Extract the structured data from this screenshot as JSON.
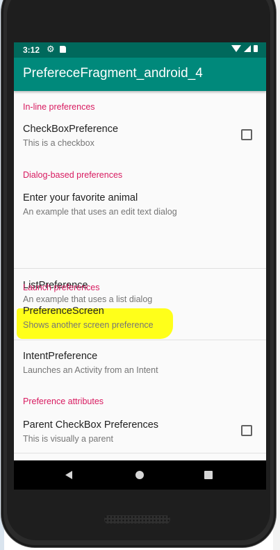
{
  "statusbar": {
    "time": "3:12"
  },
  "appbar": {
    "title": "PrefereceFragment_android_4"
  },
  "preferences": {
    "inline_header": "In-line preferences",
    "checkbox_title": "CheckBoxPreference",
    "checkbox_summary": "This is a checkbox",
    "checkbox_checked": false,
    "dialog_header": "Dialog-based preferences",
    "edittext_title": "Enter your favorite animal",
    "edittext_summary": "An example that uses an edit text dialog",
    "list_title": "ListPreference",
    "list_summary": "An example that uses a list dialog",
    "launch_header": "Launch preferences",
    "screen_title": "PreferenceScreen",
    "screen_summary": "Shows another screen preference",
    "intent_title": "IntentPreference",
    "intent_summary": "Launches an Activity from an Intent",
    "attributes_header": "Preference attributes",
    "parent_title": "Parent CheckBox Preferences",
    "parent_summary": "This is visually a parent",
    "parent_checked": false
  },
  "colors": {
    "statusbar": "#00695c",
    "appbar": "#00897b",
    "category": "#d81b60",
    "highlight": "#ffff1a"
  },
  "navbar": {
    "icons": [
      "back-icon",
      "home-icon",
      "recents-icon"
    ]
  }
}
